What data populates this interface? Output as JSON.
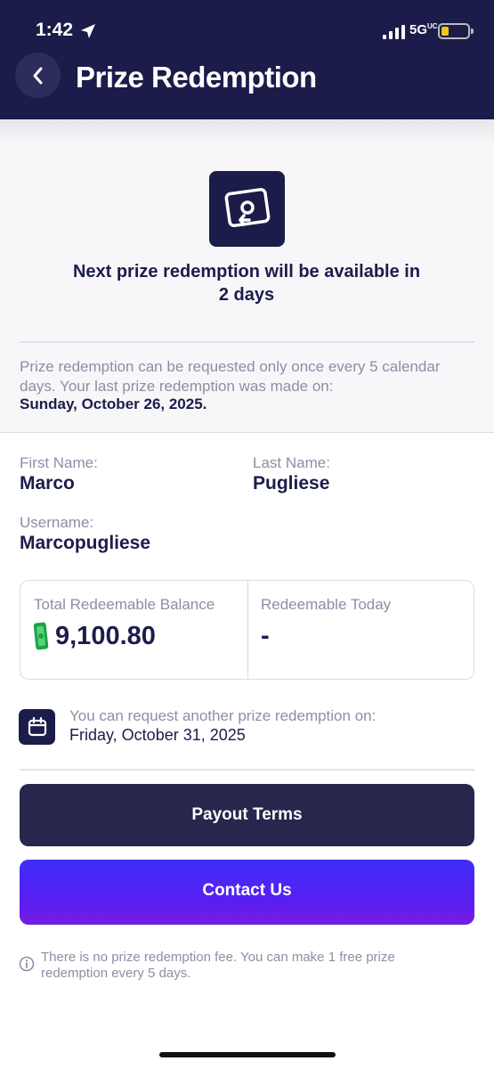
{
  "status_bar": {
    "time": "1:42",
    "network": "5G",
    "network_suffix": "UC"
  },
  "header": {
    "title": "Prize Redemption",
    "back_icon": "chevron-left-icon"
  },
  "banner": {
    "icon": "cash-redeem-icon",
    "message": "Next prize redemption will be available in 2 days"
  },
  "notice": {
    "text": "Prize redemption can be requested only once every 5 calendar days. Your last prize redemption was made on:",
    "last_date": "Sunday, October 26, 2025."
  },
  "user": {
    "first_name_label": "First Name:",
    "first_name": "Marco",
    "last_name_label": "Last Name:",
    "last_name": "Pugliese",
    "username_label": "Username:",
    "username": "Marcopugliese"
  },
  "balance": {
    "total_label": "Total Redeemable Balance",
    "total_value": "9,100.80",
    "today_label": "Redeemable Today",
    "today_value": "-"
  },
  "next_request": {
    "icon": "calendar-icon",
    "text": "You can request another prize redemption on:",
    "date": "Friday, October 31, 2025"
  },
  "buttons": {
    "terms": "Payout Terms",
    "contact": "Contact Us"
  },
  "footer": {
    "icon": "info-icon",
    "text": "There is no prize redemption fee. You can make 1 free prize redemption every 5 days."
  },
  "colors": {
    "header_bg": "#1c1c4a",
    "primary_dark": "#27274d",
    "accent_purple": "#4a22f5",
    "muted_text": "#8b8fa4"
  }
}
